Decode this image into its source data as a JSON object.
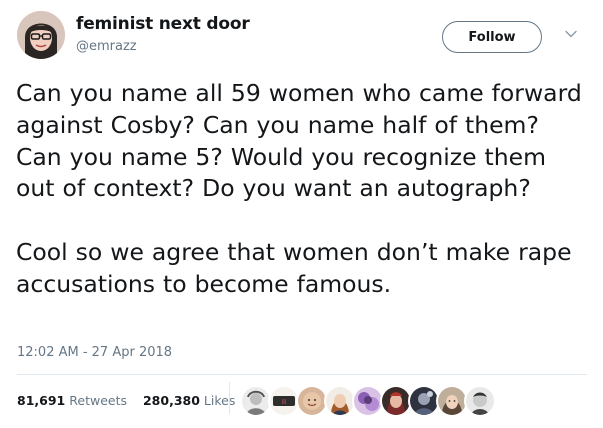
{
  "tweet": {
    "author_name": "feminist next door",
    "author_handle": "@emrazz",
    "follow_label": "Follow",
    "text": "Can you name all 59 women who came forward against Cosby? Can you name half of them? Can you name 5? Would you recognize them out of context? Do you want an autograph?\n\nCool so we agree that women don’t make rape accusations to become famous.",
    "timestamp": "12:02 AM - 27 Apr 2018",
    "retweets_count": "81,691",
    "retweets_label": "Retweets",
    "likes_count": "280,380",
    "likes_label": "Likes"
  },
  "colors": {
    "primary_text": "#14171a",
    "secondary_text": "#657786",
    "divider": "#e1e8ed"
  },
  "icons": {
    "menu": "chevron-down-icon"
  },
  "liker_avatars": [
    "liker-avatar-1",
    "liker-avatar-2",
    "liker-avatar-3",
    "liker-avatar-4",
    "liker-avatar-5",
    "liker-avatar-6",
    "liker-avatar-7",
    "liker-avatar-8",
    "liker-avatar-9"
  ]
}
